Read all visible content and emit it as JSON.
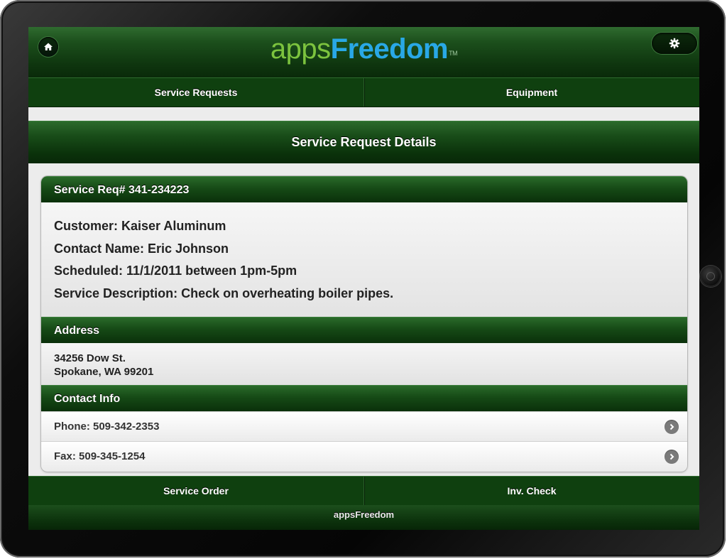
{
  "colors": {
    "brand_green": "#0f400f",
    "logo_light_green": "#7cc33e",
    "logo_blue": "#29a8e6"
  },
  "header": {
    "logo_part1": "apps",
    "logo_part2": "Freedom",
    "logo_tm": "TM",
    "home_icon": "home-icon",
    "settings_icon": "gear-icon"
  },
  "nav": {
    "tabs": [
      {
        "label": "Service Requests"
      },
      {
        "label": "Equipment"
      }
    ]
  },
  "page": {
    "title": "Service Request Details"
  },
  "request": {
    "header": "Service Req# 341-234223",
    "lines": [
      "Customer: Kaiser Aluminum",
      "Contact Name: Eric Johnson",
      "Scheduled: 11/1/2011 between 1pm-5pm",
      "Service Description: Check on overheating boiler pipes."
    ]
  },
  "address": {
    "header": "Address",
    "line1": "34256 Dow St.",
    "line2": "Spokane, WA 99201"
  },
  "contact": {
    "header": "Contact Info",
    "rows": [
      {
        "label": "Phone: 509-342-2353",
        "icon": "chevron-right-icon"
      },
      {
        "label": "Fax: 509-345-1254",
        "icon": "chevron-right-icon"
      }
    ]
  },
  "bottom_nav": {
    "tabs": [
      {
        "label": "Service Order"
      },
      {
        "label": "Inv. Check"
      }
    ]
  },
  "footer": {
    "text": "appsFreedom"
  }
}
